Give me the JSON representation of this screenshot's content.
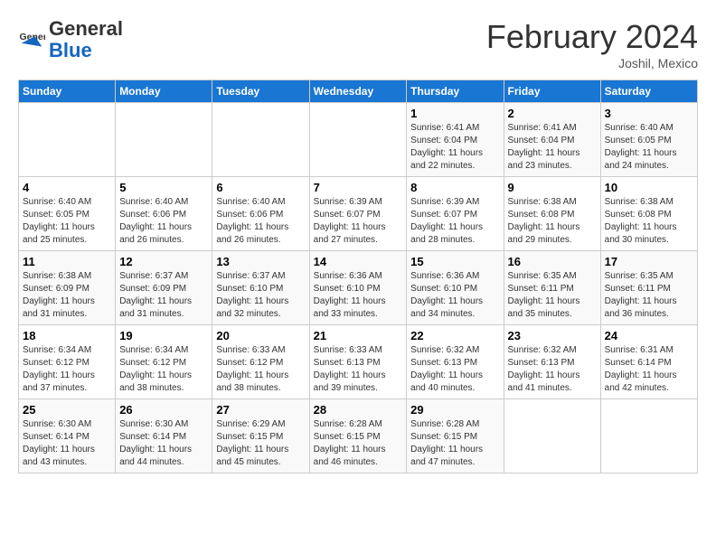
{
  "logo": {
    "general": "General",
    "blue": "Blue"
  },
  "header": {
    "month_year": "February 2024",
    "location": "Joshil, Mexico"
  },
  "days_of_week": [
    "Sunday",
    "Monday",
    "Tuesday",
    "Wednesday",
    "Thursday",
    "Friday",
    "Saturday"
  ],
  "weeks": [
    [
      {
        "day": "",
        "info": ""
      },
      {
        "day": "",
        "info": ""
      },
      {
        "day": "",
        "info": ""
      },
      {
        "day": "",
        "info": ""
      },
      {
        "day": "1",
        "info": "Sunrise: 6:41 AM\nSunset: 6:04 PM\nDaylight: 11 hours\nand 22 minutes."
      },
      {
        "day": "2",
        "info": "Sunrise: 6:41 AM\nSunset: 6:04 PM\nDaylight: 11 hours\nand 23 minutes."
      },
      {
        "day": "3",
        "info": "Sunrise: 6:40 AM\nSunset: 6:05 PM\nDaylight: 11 hours\nand 24 minutes."
      }
    ],
    [
      {
        "day": "4",
        "info": "Sunrise: 6:40 AM\nSunset: 6:05 PM\nDaylight: 11 hours\nand 25 minutes."
      },
      {
        "day": "5",
        "info": "Sunrise: 6:40 AM\nSunset: 6:06 PM\nDaylight: 11 hours\nand 26 minutes."
      },
      {
        "day": "6",
        "info": "Sunrise: 6:40 AM\nSunset: 6:06 PM\nDaylight: 11 hours\nand 26 minutes."
      },
      {
        "day": "7",
        "info": "Sunrise: 6:39 AM\nSunset: 6:07 PM\nDaylight: 11 hours\nand 27 minutes."
      },
      {
        "day": "8",
        "info": "Sunrise: 6:39 AM\nSunset: 6:07 PM\nDaylight: 11 hours\nand 28 minutes."
      },
      {
        "day": "9",
        "info": "Sunrise: 6:38 AM\nSunset: 6:08 PM\nDaylight: 11 hours\nand 29 minutes."
      },
      {
        "day": "10",
        "info": "Sunrise: 6:38 AM\nSunset: 6:08 PM\nDaylight: 11 hours\nand 30 minutes."
      }
    ],
    [
      {
        "day": "11",
        "info": "Sunrise: 6:38 AM\nSunset: 6:09 PM\nDaylight: 11 hours\nand 31 minutes."
      },
      {
        "day": "12",
        "info": "Sunrise: 6:37 AM\nSunset: 6:09 PM\nDaylight: 11 hours\nand 31 minutes."
      },
      {
        "day": "13",
        "info": "Sunrise: 6:37 AM\nSunset: 6:10 PM\nDaylight: 11 hours\nand 32 minutes."
      },
      {
        "day": "14",
        "info": "Sunrise: 6:36 AM\nSunset: 6:10 PM\nDaylight: 11 hours\nand 33 minutes."
      },
      {
        "day": "15",
        "info": "Sunrise: 6:36 AM\nSunset: 6:10 PM\nDaylight: 11 hours\nand 34 minutes."
      },
      {
        "day": "16",
        "info": "Sunrise: 6:35 AM\nSunset: 6:11 PM\nDaylight: 11 hours\nand 35 minutes."
      },
      {
        "day": "17",
        "info": "Sunrise: 6:35 AM\nSunset: 6:11 PM\nDaylight: 11 hours\nand 36 minutes."
      }
    ],
    [
      {
        "day": "18",
        "info": "Sunrise: 6:34 AM\nSunset: 6:12 PM\nDaylight: 11 hours\nand 37 minutes."
      },
      {
        "day": "19",
        "info": "Sunrise: 6:34 AM\nSunset: 6:12 PM\nDaylight: 11 hours\nand 38 minutes."
      },
      {
        "day": "20",
        "info": "Sunrise: 6:33 AM\nSunset: 6:12 PM\nDaylight: 11 hours\nand 38 minutes."
      },
      {
        "day": "21",
        "info": "Sunrise: 6:33 AM\nSunset: 6:13 PM\nDaylight: 11 hours\nand 39 minutes."
      },
      {
        "day": "22",
        "info": "Sunrise: 6:32 AM\nSunset: 6:13 PM\nDaylight: 11 hours\nand 40 minutes."
      },
      {
        "day": "23",
        "info": "Sunrise: 6:32 AM\nSunset: 6:13 PM\nDaylight: 11 hours\nand 41 minutes."
      },
      {
        "day": "24",
        "info": "Sunrise: 6:31 AM\nSunset: 6:14 PM\nDaylight: 11 hours\nand 42 minutes."
      }
    ],
    [
      {
        "day": "25",
        "info": "Sunrise: 6:30 AM\nSunset: 6:14 PM\nDaylight: 11 hours\nand 43 minutes."
      },
      {
        "day": "26",
        "info": "Sunrise: 6:30 AM\nSunset: 6:14 PM\nDaylight: 11 hours\nand 44 minutes."
      },
      {
        "day": "27",
        "info": "Sunrise: 6:29 AM\nSunset: 6:15 PM\nDaylight: 11 hours\nand 45 minutes."
      },
      {
        "day": "28",
        "info": "Sunrise: 6:28 AM\nSunset: 6:15 PM\nDaylight: 11 hours\nand 46 minutes."
      },
      {
        "day": "29",
        "info": "Sunrise: 6:28 AM\nSunset: 6:15 PM\nDaylight: 11 hours\nand 47 minutes."
      },
      {
        "day": "",
        "info": ""
      },
      {
        "day": "",
        "info": ""
      }
    ]
  ]
}
